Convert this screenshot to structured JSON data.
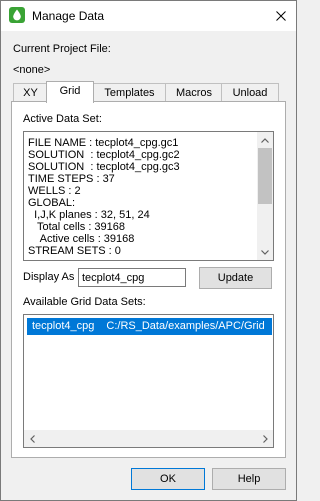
{
  "window": {
    "title": "Manage Data"
  },
  "project": {
    "label": "Current Project File:",
    "value": "<none>"
  },
  "tabs": [
    {
      "label": "XY"
    },
    {
      "label": "Grid"
    },
    {
      "label": "Templates"
    },
    {
      "label": "Macros"
    },
    {
      "label": "Unload"
    }
  ],
  "active_tab": "Grid",
  "grid_tab": {
    "active_data_set_label": "Active Data Set:",
    "info_lines": [
      "FILE NAME : tecplot4_cpg.gc1",
      "SOLUTION  : tecplot4_cpg.gc2",
      "SOLUTION  : tecplot4_cpg.gc3",
      "TIME STEPS : 37",
      "WELLS : 2",
      "GLOBAL:",
      "  I,J,K planes : 32, 51, 24",
      "   Total cells : 39168",
      "    Active cells : 39168",
      "STREAM SETS : 0"
    ],
    "display_as_label": "Display As",
    "display_as_value": "tecplot4_cpg",
    "update_label": "Update",
    "available_label": "Available Grid Data Sets:",
    "datasets": [
      {
        "name": "tecplot4_cpg",
        "path": "C:/RS_Data/examples/APC/Grid"
      }
    ]
  },
  "buttons": {
    "ok": "OK",
    "help": "Help"
  },
  "colors": {
    "selection": "#0078d7",
    "app_icon": "#3aa335"
  }
}
